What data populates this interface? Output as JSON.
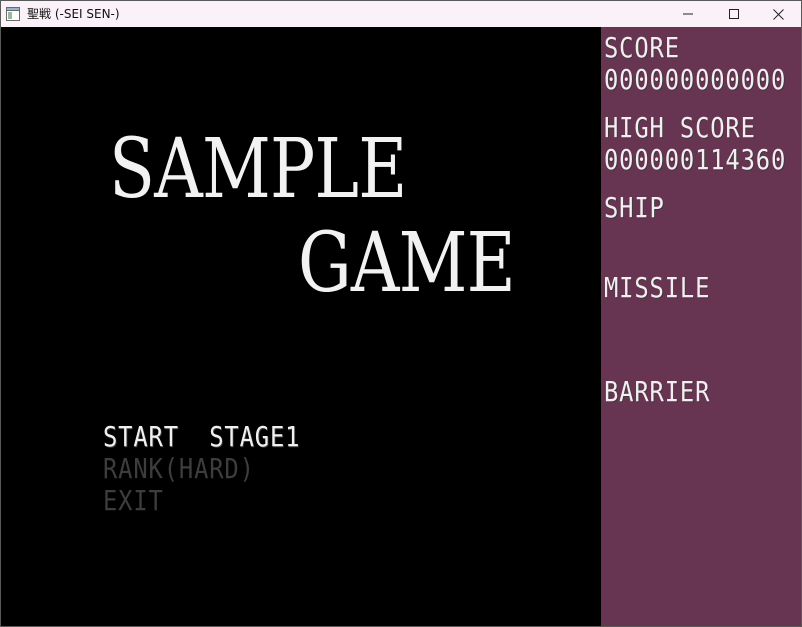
{
  "window": {
    "title": "聖戦 (-SEI SEN-)"
  },
  "game": {
    "title_line1": "SAMPLE",
    "title_line2": "GAME",
    "menu": {
      "start": "START  STAGE1",
      "rank": "RANK(HARD)",
      "exit": "EXIT"
    }
  },
  "sidebar": {
    "score_label": "SCORE",
    "score_value": "000000000000",
    "high_score_label": "HIGH SCORE",
    "high_score_value": "000000114360",
    "ship_label": "SHIP",
    "missile_label": "MISSILE",
    "barrier_label": "BARRIER"
  },
  "colors": {
    "titlebar_bg": "#fbf1f8",
    "game_bg": "#000000",
    "sidebar_bg": "#673452",
    "menu_selected": "#f0f0f0",
    "menu_unselected": "#3d3d3d"
  },
  "icons": {
    "app": "window-app-icon",
    "minimize": "minimize-icon",
    "maximize": "maximize-icon",
    "close": "close-icon"
  }
}
